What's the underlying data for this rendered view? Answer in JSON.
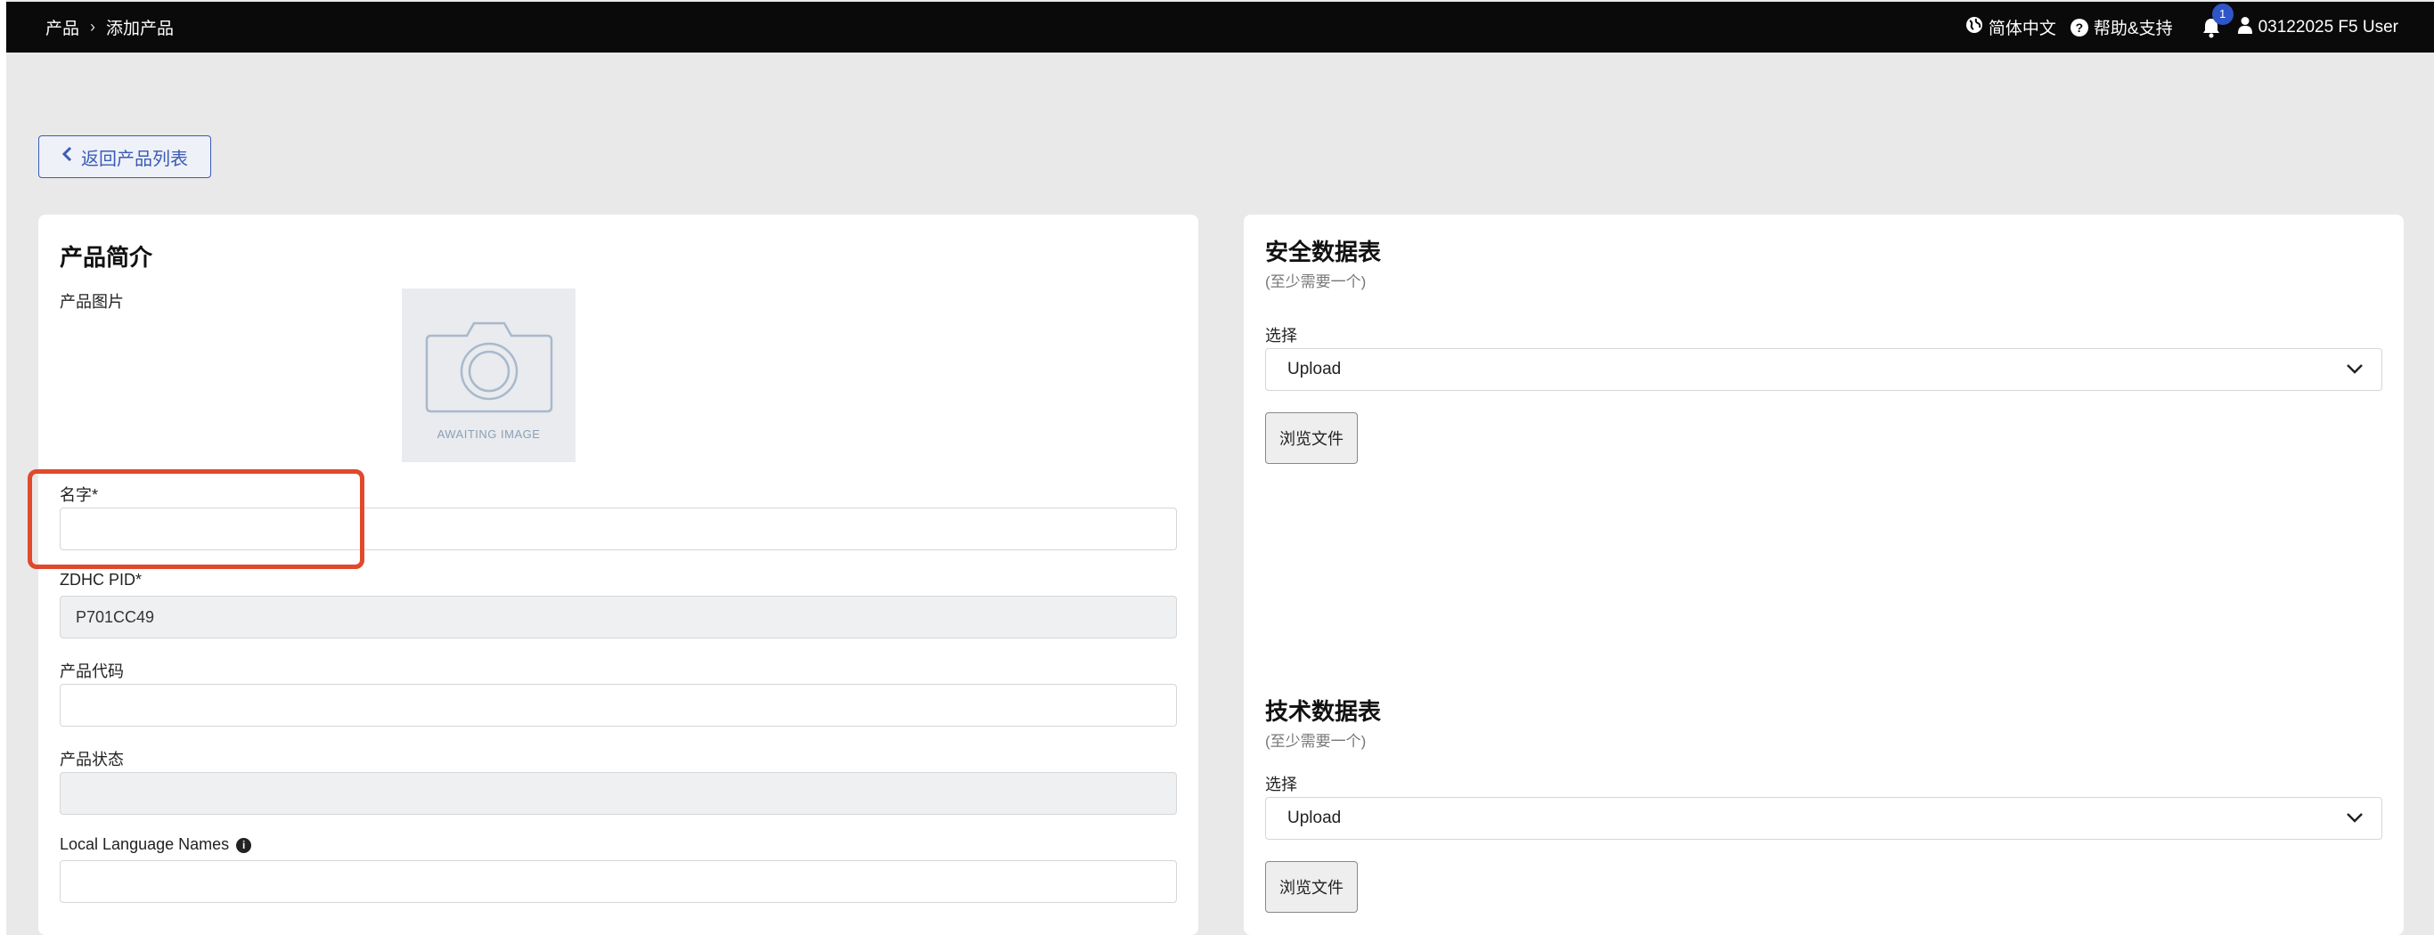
{
  "breadcrumb": {
    "root": "产品",
    "separator": "›",
    "current": "添加产品"
  },
  "topbar": {
    "language_label": "简体中文",
    "help_label": "帮助&支持",
    "notification_count": "1",
    "user_label": "03122025 F5 User"
  },
  "back_button": {
    "label": "返回产品列表"
  },
  "profile": {
    "title": "产品简介",
    "image_label": "产品图片",
    "image_placeholder_text": "AWAITING IMAGE",
    "name_label": "名字*",
    "name_value": "",
    "pid_label": "ZDHC PID*",
    "pid_value": "P701CC49",
    "code_label": "产品代码",
    "code_value": "",
    "status_label": "产品状态",
    "status_value": "",
    "local_names_label": "Local Language Names",
    "local_names_value": ""
  },
  "safety_sheet": {
    "title": "安全数据表",
    "subtitle": "(至少需要一个)",
    "select_label": "选择",
    "select_value": "Upload",
    "browse_label": "浏览文件"
  },
  "tech_sheet": {
    "title": "技术数据表",
    "subtitle": "(至少需要一个)",
    "select_label": "选择",
    "select_value": "Upload",
    "browse_label": "浏览文件"
  },
  "colors": {
    "topbar": "#0a0a0a",
    "accent": "#3a5bb8",
    "highlight": "#e0492c",
    "page_bg": "#e9e9e9"
  }
}
